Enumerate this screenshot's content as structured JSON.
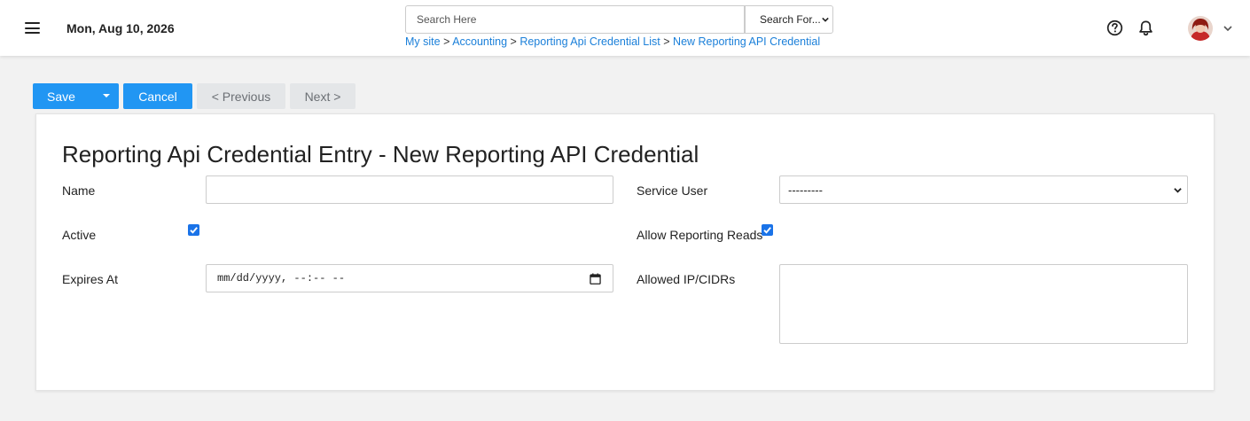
{
  "header": {
    "menu_icon": "hamburger-icon",
    "date": "Mon, Aug 10, 2026",
    "search": {
      "placeholder": "Search Here",
      "scope_selected": "Search For..."
    },
    "breadcrumb": [
      {
        "label": "My site"
      },
      {
        "label": "Accounting"
      },
      {
        "label": "Reporting Api Credential List"
      },
      {
        "label": "New Reporting API Credential"
      }
    ],
    "breadcrumb_separator": ">",
    "icons": [
      "help-circle-icon",
      "bell-icon",
      "user-avatar",
      "chevron-down-icon"
    ]
  },
  "toolbar": {
    "save_label": "Save",
    "cancel_label": "Cancel",
    "previous_label": "< Previous",
    "next_label": "Next >"
  },
  "form": {
    "title": "Reporting Api Credential Entry - New Reporting API Credential",
    "fields": {
      "name": {
        "label": "Name",
        "value": ""
      },
      "service_user": {
        "label": "Service User",
        "selected": "---------"
      },
      "active": {
        "label": "Active",
        "checked": true
      },
      "allow_reporting_reads": {
        "label": "Allow Reporting Reads",
        "checked": true
      },
      "expires_at": {
        "label": "Expires At",
        "value": "mm/dd/yyyy, --:-- --"
      },
      "allowed_ip_cidrs": {
        "label": "Allowed IP/CIDRs",
        "value": ""
      }
    }
  },
  "colors": {
    "primary": "#2196f3",
    "link": "#1a7fd9",
    "checkbox": "#1a73e8",
    "muted_button": "#e4e6e8",
    "background": "#f2f2f2"
  }
}
